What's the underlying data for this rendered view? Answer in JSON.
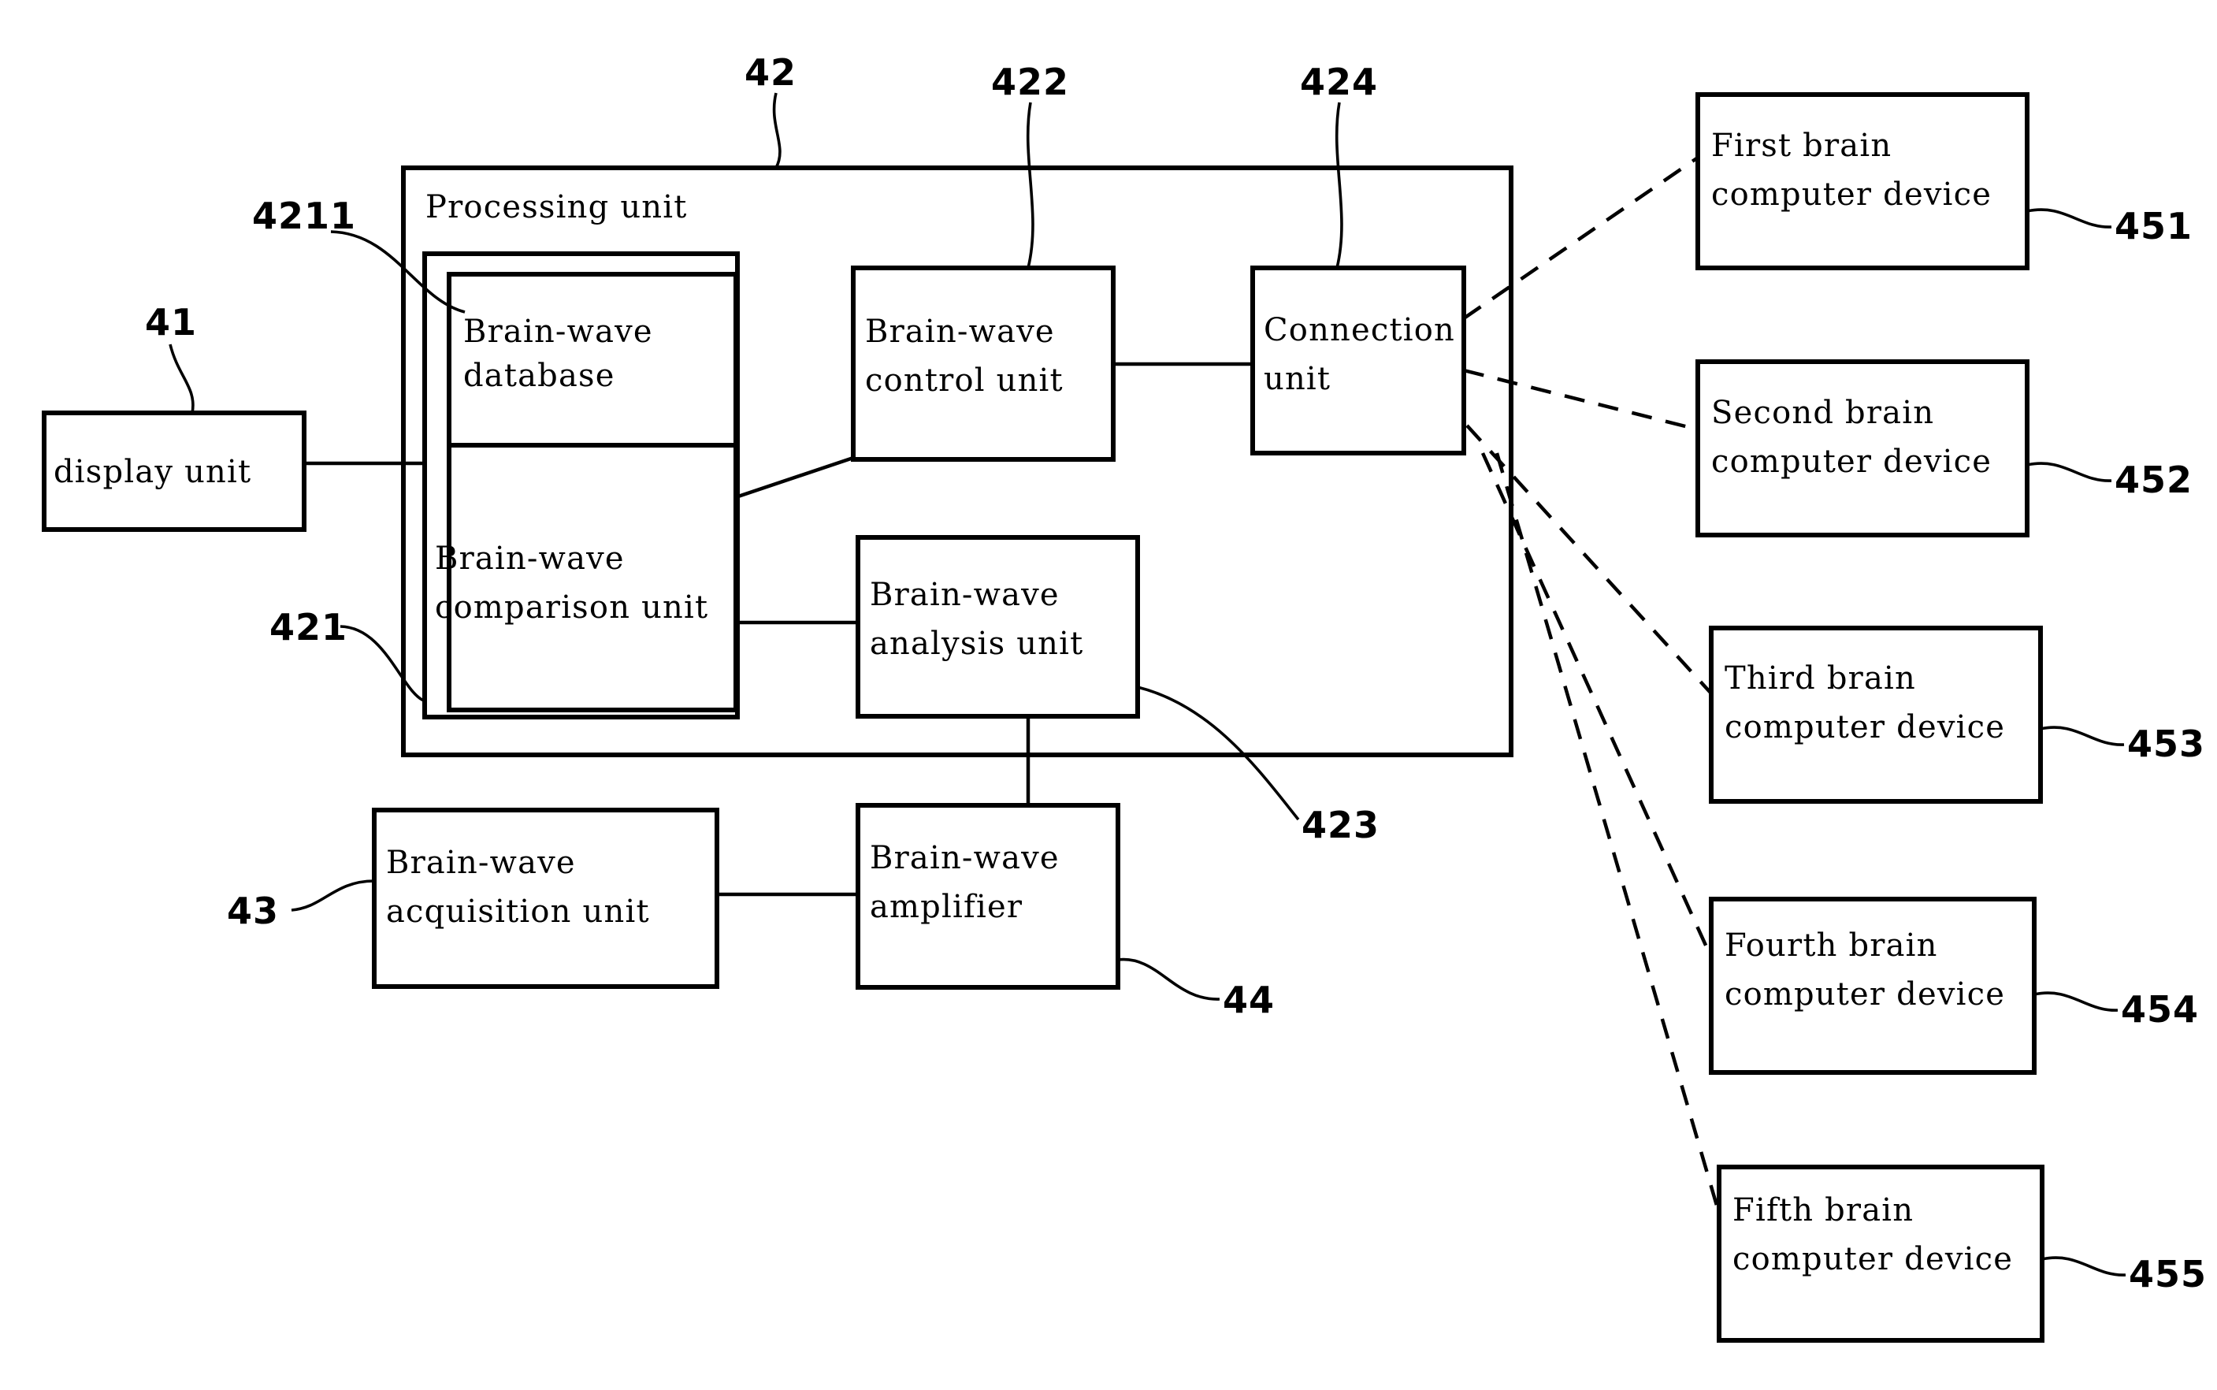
{
  "figure": {
    "title": "Brain-wave processing system block diagram",
    "type": "patent-block-diagram"
  },
  "boxes": {
    "processing_unit": {
      "label": "Processing unit",
      "ref": "42"
    },
    "brainwave_comparison_unit": {
      "label_line1": "Brain-wave",
      "label_line2": "comparison unit",
      "ref": "421"
    },
    "brainwave_database": {
      "label_line1": "Brain-wave",
      "label_line2": "database",
      "ref": "4211"
    },
    "brainwave_control_unit": {
      "label_line1": "Brain-wave",
      "label_line2": "control unit",
      "ref": "422"
    },
    "connection_unit": {
      "label_line1": "Connection",
      "label_line2": "unit",
      "ref": "424"
    },
    "brainwave_analysis_unit": {
      "label_line1": "Brain-wave",
      "label_line2": "analysis unit",
      "ref": "423"
    },
    "display_unit": {
      "label": "display unit",
      "ref": "41"
    },
    "brainwave_acquisition_unit": {
      "label_line1": "Brain-wave",
      "label_line2": "acquisition unit",
      "ref": "43"
    },
    "brainwave_amplifier": {
      "label_line1": "Brain-wave",
      "label_line2": "amplifier",
      "ref": "44"
    }
  },
  "devices": [
    {
      "label_line1": "First brain",
      "label_line2": "computer device",
      "ref": "451"
    },
    {
      "label_line1": "Second brain",
      "label_line2": "computer device",
      "ref": "452"
    },
    {
      "label_line1": "Third brain",
      "label_line2": "computer device",
      "ref": "453"
    },
    {
      "label_line1": "Fourth brain",
      "label_line2": "computer device",
      "ref": "454"
    },
    {
      "label_line1": "Fifth brain",
      "label_line2": "computer device",
      "ref": "455"
    }
  ],
  "colors": {
    "ink": "#000000",
    "paper": "#ffffff"
  }
}
